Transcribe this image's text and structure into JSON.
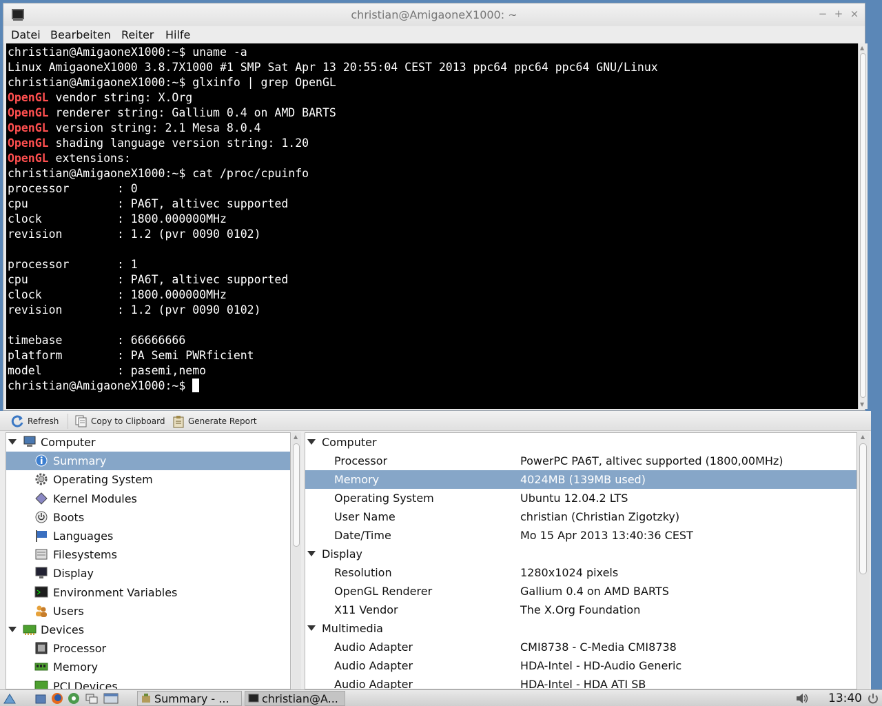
{
  "terminal": {
    "title": "christian@AmigaoneX1000: ~",
    "menu": [
      "Datei",
      "Bearbeiten",
      "Reiter",
      "Hilfe"
    ],
    "lines": [
      "christian@AmigaoneX1000:~$ uname -a",
      "Linux AmigaoneX1000 3.8.7X1000 #1 SMP Sat Apr 13 20:55:04 CEST 2013 ppc64 ppc64 ppc64 GNU/Linux",
      "christian@AmigaoneX1000:~$ glxinfo | grep OpenGL",
      " vendor string: X.Org",
      " renderer string: Gallium 0.4 on AMD BARTS",
      " version string: 2.1 Mesa 8.0.4",
      " shading language version string: 1.20",
      " extensions:",
      "christian@AmigaoneX1000:~$ cat /proc/cpuinfo",
      "processor       : 0",
      "cpu             : PA6T, altivec supported",
      "clock           : 1800.000000MHz",
      "revision        : 1.2 (pvr 0090 0102)",
      "",
      "processor       : 1",
      "cpu             : PA6T, altivec supported",
      "clock           : 1800.000000MHz",
      "revision        : 1.2 (pvr 0090 0102)",
      "",
      "timebase        : 66666666",
      "platform        : PA Semi PWRficient",
      "model           : pasemi,nemo",
      "christian@AmigaoneX1000:~$ "
    ],
    "highlight_word": "OpenGL",
    "highlight_color": "#ff4f4f"
  },
  "hardinfo": {
    "toolbar": {
      "refresh": "Refresh",
      "copy": "Copy to Clipboard",
      "report": "Generate Report"
    },
    "tree": [
      {
        "label": "Computer",
        "level": 0,
        "icon": "computer-icon"
      },
      {
        "label": "Summary",
        "level": 1,
        "icon": "info-icon",
        "selected": true
      },
      {
        "label": "Operating System",
        "level": 1,
        "icon": "gear-icon"
      },
      {
        "label": "Kernel Modules",
        "level": 1,
        "icon": "module-icon"
      },
      {
        "label": "Boots",
        "level": 1,
        "icon": "power-icon"
      },
      {
        "label": "Languages",
        "level": 1,
        "icon": "flag-icon"
      },
      {
        "label": "Filesystems",
        "level": 1,
        "icon": "disk-icon"
      },
      {
        "label": "Display",
        "level": 1,
        "icon": "monitor-icon"
      },
      {
        "label": "Environment Variables",
        "level": 1,
        "icon": "terminal-icon"
      },
      {
        "label": "Users",
        "level": 1,
        "icon": "users-icon"
      },
      {
        "label": "Devices",
        "level": 0,
        "icon": "devices-icon"
      },
      {
        "label": "Processor",
        "level": 1,
        "icon": "cpu-icon"
      },
      {
        "label": "Memory",
        "level": 1,
        "icon": "memory-icon"
      },
      {
        "label": "PCI Devices",
        "level": 1,
        "icon": "pci-icon"
      }
    ],
    "details": [
      {
        "section": "Computer"
      },
      {
        "key": "Processor",
        "value": "PowerPC PA6T, altivec supported (1800,00MHz)"
      },
      {
        "key": "Memory",
        "value": "4024MB (139MB used)",
        "selected": true
      },
      {
        "key": "Operating System",
        "value": "Ubuntu 12.04.2 LTS"
      },
      {
        "key": "User Name",
        "value": "christian (Christian Zigotzky)"
      },
      {
        "key": "Date/Time",
        "value": "Mo 15 Apr 2013 13:40:36 CEST"
      },
      {
        "section": "Display"
      },
      {
        "key": "Resolution",
        "value": "1280x1024 pixels"
      },
      {
        "key": "OpenGL Renderer",
        "value": "Gallium 0.4 on AMD BARTS"
      },
      {
        "key": "X11 Vendor",
        "value": "The X.Org Foundation"
      },
      {
        "section": "Multimedia"
      },
      {
        "key": "Audio Adapter",
        "value": "CMI8738 - C-Media CMI8738"
      },
      {
        "key": "Audio Adapter",
        "value": "HDA-Intel - HD-Audio Generic"
      },
      {
        "key": "Audio Adapter",
        "value": "HDA-Intel - HDA ATI SB"
      }
    ],
    "selection_color": "#86a6c8"
  },
  "taskbar": {
    "tasks": [
      "Summary - ...",
      "christian@A..."
    ],
    "clock": "13:40"
  }
}
